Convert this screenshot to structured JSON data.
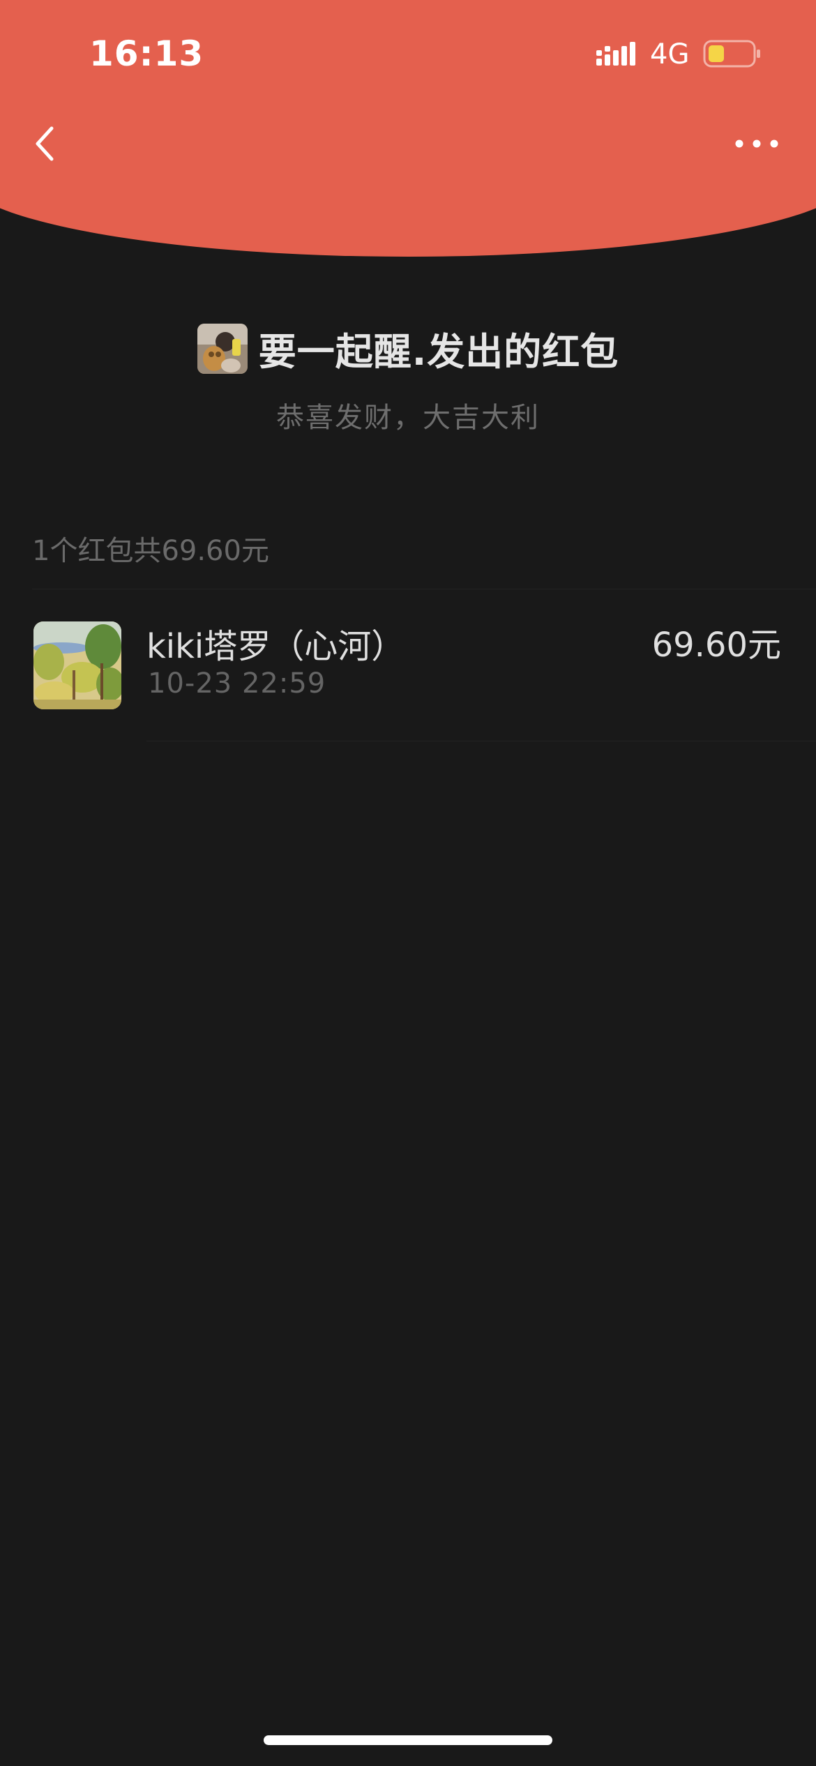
{
  "status_bar": {
    "time": "16:13",
    "network": "4G",
    "battery_color": "#f5d547"
  },
  "header": {
    "bg_color": "#e4604e",
    "back_icon": "chevron-left-icon",
    "more_icon": "more-dots-icon"
  },
  "sender": {
    "title": "要一起醒.发出的红包",
    "greeting": "恭喜发财，大吉大利"
  },
  "summary": {
    "text": "1个红包共69.60元"
  },
  "records": [
    {
      "name": "kiki塔罗（心河）",
      "time": "10-23 22:59",
      "amount": "69.60元"
    }
  ]
}
